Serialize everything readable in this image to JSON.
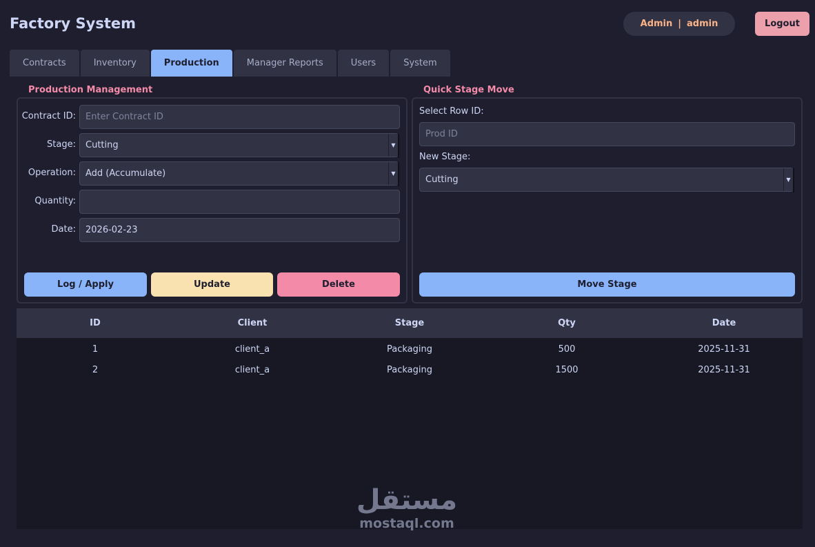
{
  "header": {
    "title": "Factory System",
    "user_role": "Admin",
    "user_sep": "|",
    "user_name": "admin",
    "logout_label": "Logout"
  },
  "tabs": [
    {
      "label": "Contracts",
      "active": false
    },
    {
      "label": "Inventory",
      "active": false
    },
    {
      "label": "Production",
      "active": true
    },
    {
      "label": "Manager Reports",
      "active": false
    },
    {
      "label": "Users",
      "active": false
    },
    {
      "label": "System",
      "active": false
    }
  ],
  "production": {
    "title": "Production Management",
    "contract_label": "Contract ID:",
    "contract_value": "",
    "contract_placeholder": "Enter Contract ID",
    "stage_label": "Stage:",
    "stage_value": "Cutting",
    "operation_label": "Operation:",
    "operation_value": "Add (Accumulate)",
    "quantity_label": "Quantity:",
    "quantity_value": "",
    "date_label": "Date:",
    "date_value": "2026-02-23",
    "log_label": "Log / Apply",
    "update_label": "Update",
    "delete_label": "Delete"
  },
  "quick_move": {
    "title": "Quick Stage Move",
    "row_label": "Select Row ID:",
    "row_placeholder": "Prod ID",
    "stage_label": "New Stage:",
    "stage_value": "Cutting",
    "move_label": "Move Stage"
  },
  "table": {
    "columns": [
      "ID",
      "Client",
      "Stage",
      "Qty",
      "Date"
    ],
    "rows": [
      [
        "1",
        "client_a",
        "Packaging",
        "500",
        "2025-11-31"
      ],
      [
        "2",
        "client_a",
        "Packaging",
        "1500",
        "2025-11-31"
      ]
    ]
  },
  "watermark": {
    "logo_text": "مستقل",
    "url": "mostaql.com"
  },
  "colors": {
    "background": "#1e1e2e",
    "accent_blue": "#89b4fa",
    "accent_yellow": "#f9e2af",
    "accent_pink": "#f38ba8",
    "accent_peach": "#fab387"
  }
}
